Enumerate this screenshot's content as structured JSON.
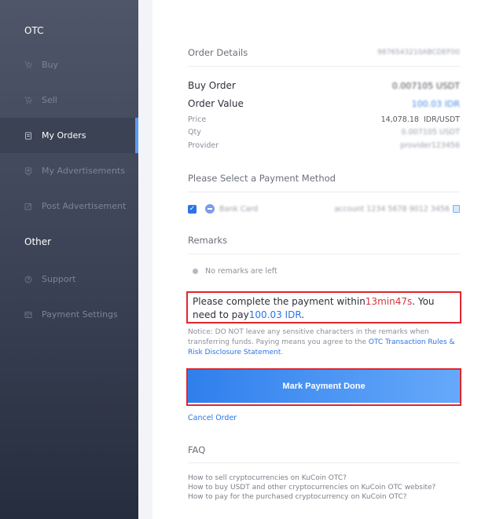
{
  "sidebar": {
    "sections": [
      {
        "title": "OTC"
      },
      {
        "title": "Other"
      }
    ],
    "items": [
      {
        "label": "Buy",
        "icon": "cart-down-icon"
      },
      {
        "label": "Sell",
        "icon": "cart-up-icon"
      },
      {
        "label": "My Orders",
        "icon": "orders-icon",
        "active": true
      },
      {
        "label": "My Advertisements",
        "icon": "advertisements-icon"
      },
      {
        "label": "Post Advertisement",
        "icon": "edit-icon"
      },
      {
        "label": "Support",
        "icon": "support-icon"
      },
      {
        "label": "Payment Settings",
        "icon": "card-icon"
      }
    ],
    "accent_color": "#5a9bf0"
  },
  "order": {
    "title": "Order Details",
    "order_id": "9876543210ABCDEF00",
    "buy_order_label": "Buy Order",
    "buy_order_value": "0.007105 USDT",
    "order_value_label": "Order Value",
    "order_value_value": "100.03 IDR",
    "price_label": "Price",
    "price_value": "14,078.18  IDR/USDT",
    "qty_label": "Qty",
    "qty_value": "0.007105 USDT",
    "provider_label": "Provider",
    "provider_value": "provider123456"
  },
  "payment": {
    "title": "Please Select a Payment Method",
    "method_name": "Bank Card",
    "method_account": "account 1234 5678 9012 3456",
    "checked": true
  },
  "remarks": {
    "title": "Remarks",
    "empty_text": "No remarks are left"
  },
  "alert": {
    "prefix": "Please complete the payment within",
    "time_left": "13min47s",
    "middle": ". You need to pay",
    "amount": "100.03 IDR",
    "suffix": "."
  },
  "notice": {
    "text": "Notice: DO NOT leave any sensitive characters in the remarks when transferring funds. Paying means you agree to the ",
    "link": "OTC Transaction Rules & Risk Disclosure Statement",
    "end": "."
  },
  "actions": {
    "mark_done": "Mark Payment Done",
    "cancel": "Cancel Order"
  },
  "faq": {
    "title": "FAQ",
    "links": [
      "How to sell cryptocurrencies on KuCoin OTC?",
      "How to buy USDT and other cryptocurrencies on KuCoin OTC website?",
      "How to pay for the purchased cryptocurrency on KuCoin OTC?"
    ]
  },
  "colors": {
    "primary": "#2a74e6",
    "danger": "#e0262d",
    "timer": "#d5363e"
  }
}
